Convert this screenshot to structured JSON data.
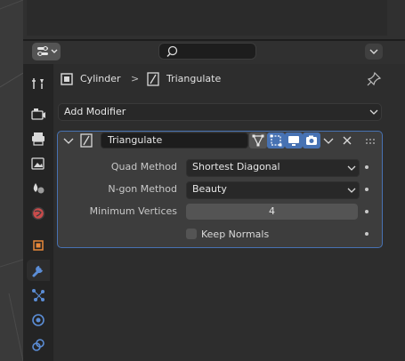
{
  "header": {
    "search_placeholder": ""
  },
  "breadcrumb": {
    "object": "Cylinder",
    "separator": ">",
    "modifier": "Triangulate"
  },
  "add_modifier_label": "Add Modifier",
  "modifier": {
    "name": "Triangulate",
    "fields": {
      "quad_method_label": "Quad Method",
      "quad_method_value": "Shortest Diagonal",
      "ngon_method_label": "N-gon Method",
      "ngon_method_value": "Beauty",
      "min_vertices_label": "Minimum Vertices",
      "min_vertices_value": "4",
      "keep_normals_label": "Keep Normals",
      "keep_normals_checked": false
    }
  },
  "tabs": [
    "tool",
    "render",
    "output",
    "view-layer",
    "scene",
    "world",
    "object",
    "modifiers",
    "particles",
    "physics",
    "constraints"
  ],
  "colors": {
    "accent": "#4772b3",
    "active_modifier_tab": "#5b8dd6"
  }
}
